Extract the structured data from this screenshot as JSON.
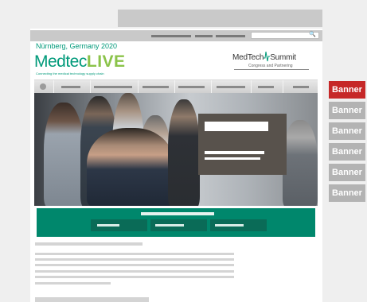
{
  "header": {
    "event_date": "Nürnberg, Germany 2020",
    "logo_main": "Medtec",
    "logo_accent": "LIVE",
    "tagline": "Connecting the medical technology supply chain",
    "partner_logo_main": "MedTech",
    "partner_logo_accent": "Summit",
    "partner_logo_sub": "Congress and Partnering"
  },
  "search": {
    "icon": "magnifier-icon",
    "glyph": "🔍"
  },
  "nav": {
    "home_icon": "home-icon"
  },
  "banners": [
    {
      "label": "Banner",
      "color": "#c62828"
    },
    {
      "label": "Banner",
      "color": "#b3b3b3"
    },
    {
      "label": "Banner",
      "color": "#b3b3b3"
    },
    {
      "label": "Banner",
      "color": "#b3b3b3"
    },
    {
      "label": "Banner",
      "color": "#b3b3b3"
    },
    {
      "label": "Banner",
      "color": "#b3b3b3"
    }
  ],
  "colors": {
    "brand": "#009a7a",
    "brand_dark": "#00876c",
    "accent_live": "#8bc34a",
    "banner_active": "#c62828",
    "banner_inactive": "#b3b3b3"
  }
}
